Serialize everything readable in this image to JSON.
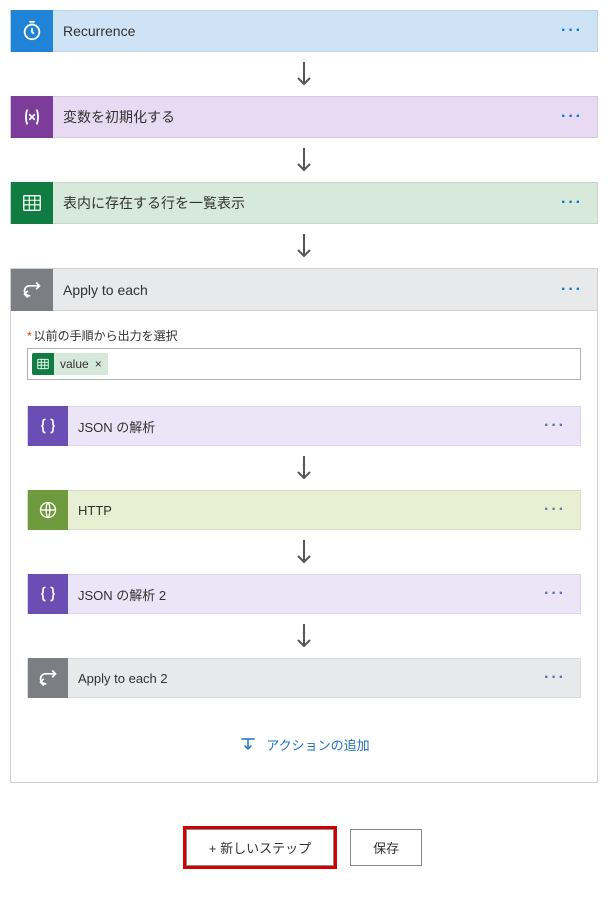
{
  "steps": {
    "recurrence": {
      "label": "Recurrence"
    },
    "variable": {
      "label": "変数を初期化する"
    },
    "excel": {
      "label": "表内に存在する行を一覧表示"
    },
    "loop": {
      "label": "Apply to each"
    }
  },
  "loop": {
    "field_label": "以前の手順から出力を選択",
    "token": {
      "label": "value",
      "remove": "×"
    },
    "inner": {
      "json1": {
        "label": "JSON の解析"
      },
      "http": {
        "label": "HTTP"
      },
      "json2": {
        "label": "JSON の解析 2"
      },
      "loop2": {
        "label": "Apply to each 2"
      }
    },
    "add_action": "アクションの追加"
  },
  "footer": {
    "new_step": "+ 新しいステップ",
    "save": "保存"
  },
  "menu_dots": "···"
}
